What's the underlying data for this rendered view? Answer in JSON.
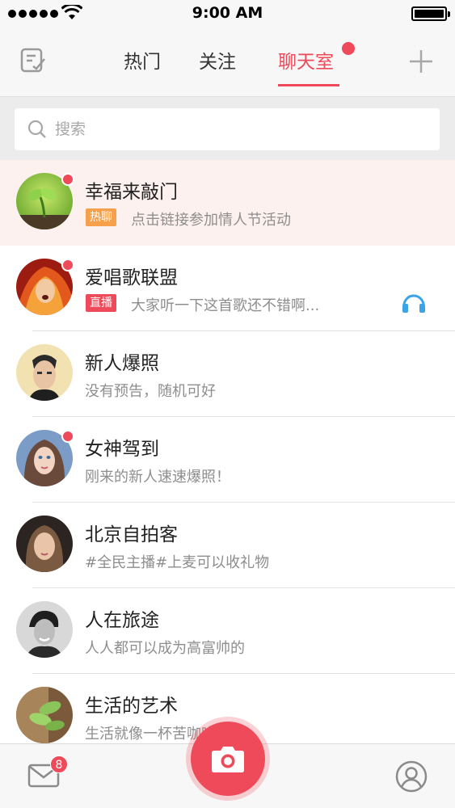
{
  "status_bar": {
    "time": "9:00 AM"
  },
  "nav": {
    "tabs": [
      {
        "label": "热门"
      },
      {
        "label": "关注"
      },
      {
        "label": "聊天室"
      }
    ],
    "active_tab": "聊天室",
    "icons": [
      "edit-icon",
      "plus-icon"
    ]
  },
  "search": {
    "placeholder": "搜索"
  },
  "rooms": [
    {
      "name": "幸福来敲门",
      "tag": "热聊",
      "tag_color": "#f7a04b",
      "subtitle": "点击链接参加情人节活动",
      "unread": true,
      "highlighted": true
    },
    {
      "name": "爱唱歌联盟",
      "tag": "直播",
      "tag_color": "#ee4a5a",
      "subtitle": "大家听一下这首歌还不错啊...",
      "unread": true,
      "icon": "headphone-icon"
    },
    {
      "name": "新人爆照",
      "subtitle": "没有预告，随机可好",
      "unread": false
    },
    {
      "name": "女神驾到",
      "subtitle": "刚来的新人速速爆照！",
      "unread": true
    },
    {
      "name": "北京自拍客",
      "subtitle": "#全民主播#上麦可以收礼物",
      "unread": false
    },
    {
      "name": "人在旅途",
      "subtitle": "人人都可以成为高富帅的",
      "unread": false
    },
    {
      "name": "生活的艺术",
      "subtitle": "生活就像一杯苦咖啡",
      "unread": false
    }
  ],
  "bottom_bar": {
    "mail_badge": "8",
    "icons": [
      "mail-icon",
      "camera-icon",
      "profile-icon"
    ]
  },
  "colors": {
    "accent": "#ee4a5a",
    "hot_tag": "#f7a04b",
    "headphone": "#3ba3e8"
  }
}
